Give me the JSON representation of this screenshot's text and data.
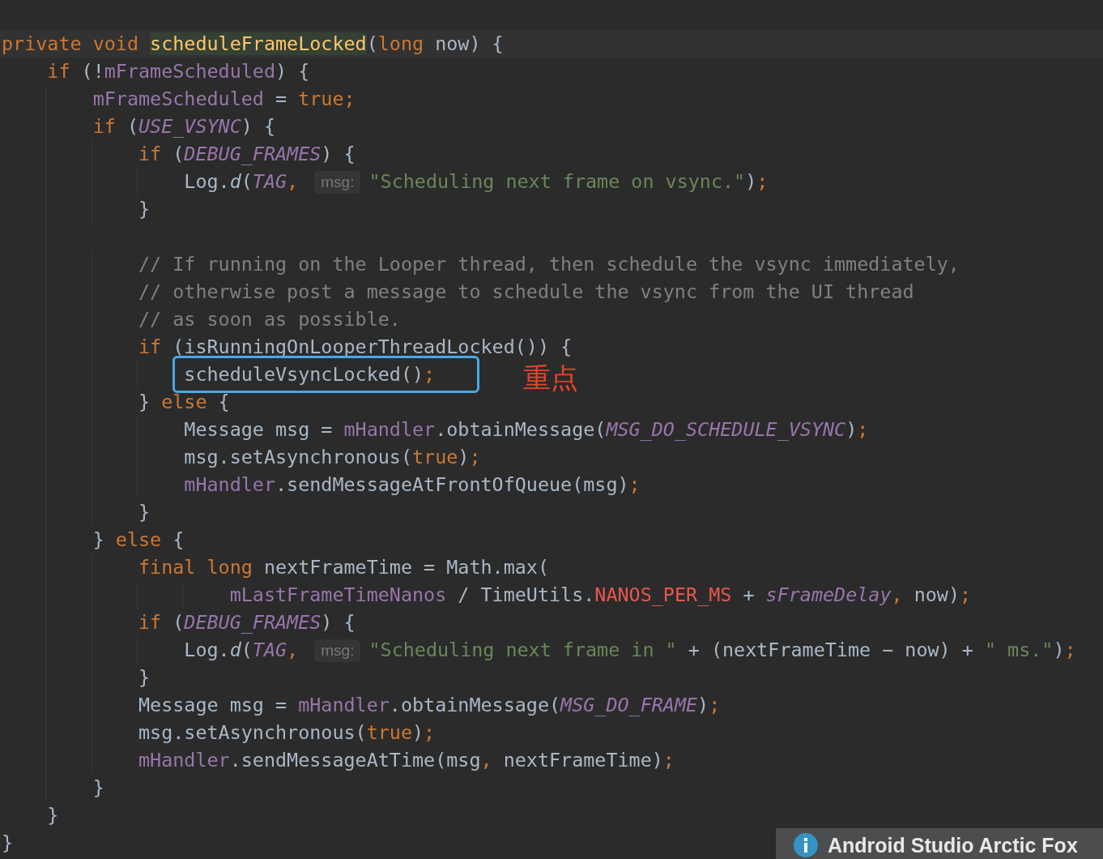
{
  "lines": [
    {
      "current": true,
      "tokens": [
        {
          "kind": "kw",
          "text": "private void "
        },
        {
          "kind": "decl",
          "text": "scheduleFrameLocked"
        },
        {
          "kind": "plain",
          "text": "("
        },
        {
          "kind": "kw",
          "text": "long "
        },
        {
          "kind": "plain",
          "text": "now) {"
        }
      ]
    },
    {
      "tokens": [
        {
          "kind": "kw",
          "text": "    if "
        },
        {
          "kind": "plain",
          "text": "(!"
        },
        {
          "kind": "field",
          "text": "mFrameScheduled"
        },
        {
          "kind": "plain",
          "text": ") {"
        }
      ]
    },
    {
      "tokens": [
        {
          "kind": "field",
          "text": "        mFrameScheduled"
        },
        {
          "kind": "plain",
          "text": " = "
        },
        {
          "kind": "kw",
          "text": "true;"
        }
      ]
    },
    {
      "tokens": [
        {
          "kind": "kw",
          "text": "        if "
        },
        {
          "kind": "plain",
          "text": "("
        },
        {
          "kind": "static",
          "text": "USE_VSYNC"
        },
        {
          "kind": "plain",
          "text": ") {"
        }
      ]
    },
    {
      "tokens": [
        {
          "kind": "kw",
          "text": "            if "
        },
        {
          "kind": "plain",
          "text": "("
        },
        {
          "kind": "static",
          "text": "DEBUG_FRAMES"
        },
        {
          "kind": "plain",
          "text": ") {"
        }
      ]
    },
    {
      "tokens": [
        {
          "kind": "plain",
          "text": "                Log."
        },
        {
          "kind": "italic",
          "text": "d"
        },
        {
          "kind": "plain",
          "text": "("
        },
        {
          "kind": "static",
          "text": "TAG"
        },
        {
          "kind": "kw",
          "text": ", "
        },
        {
          "kind": "hint",
          "text": "msg:"
        },
        {
          "kind": "string",
          "text": "\"Scheduling next frame on vsync.\""
        },
        {
          "kind": "plain",
          "text": ")"
        },
        {
          "kind": "kw",
          "text": ";"
        }
      ]
    },
    {
      "tokens": [
        {
          "kind": "plain",
          "text": "            }"
        }
      ]
    },
    {
      "blank": true
    },
    {
      "tokens": [
        {
          "kind": "comment",
          "text": "            // If running on the Looper thread, then schedule the vsync immediately,"
        }
      ]
    },
    {
      "tokens": [
        {
          "kind": "comment",
          "text": "            // otherwise post a message to schedule the vsync from the UI thread"
        }
      ]
    },
    {
      "tokens": [
        {
          "kind": "comment",
          "text": "            // as soon as possible."
        }
      ]
    },
    {
      "tokens": [
        {
          "kind": "kw",
          "text": "            if "
        },
        {
          "kind": "plain",
          "text": "(isRunningOnLooperThreadLocked()) {"
        }
      ]
    },
    {
      "boxed": true,
      "note": "重点",
      "tokens": [
        {
          "kind": "plain",
          "text": "                scheduleVsyncLocked()"
        },
        {
          "kind": "kw",
          "text": ";"
        }
      ]
    },
    {
      "tokens": [
        {
          "kind": "plain",
          "text": "            } "
        },
        {
          "kind": "kw",
          "text": "else "
        },
        {
          "kind": "plain",
          "text": "{"
        }
      ]
    },
    {
      "tokens": [
        {
          "kind": "plain",
          "text": "                Message msg = "
        },
        {
          "kind": "field",
          "text": "mHandler"
        },
        {
          "kind": "plain",
          "text": ".obtainMessage("
        },
        {
          "kind": "static",
          "text": "MSG_DO_SCHEDULE_VSYNC"
        },
        {
          "kind": "plain",
          "text": ")"
        },
        {
          "kind": "kw",
          "text": ";"
        }
      ]
    },
    {
      "tokens": [
        {
          "kind": "plain",
          "text": "                msg.setAsynchronous("
        },
        {
          "kind": "kw",
          "text": "true"
        },
        {
          "kind": "plain",
          "text": ")"
        },
        {
          "kind": "kw",
          "text": ";"
        }
      ]
    },
    {
      "tokens": [
        {
          "kind": "field",
          "text": "                mHandler"
        },
        {
          "kind": "plain",
          "text": ".sendMessageAtFrontOfQueue(msg)"
        },
        {
          "kind": "kw",
          "text": ";"
        }
      ]
    },
    {
      "tokens": [
        {
          "kind": "plain",
          "text": "            }"
        }
      ]
    },
    {
      "tokens": [
        {
          "kind": "plain",
          "text": "        } "
        },
        {
          "kind": "kw",
          "text": "else "
        },
        {
          "kind": "plain",
          "text": "{"
        }
      ]
    },
    {
      "tokens": [
        {
          "kind": "kw",
          "text": "            final long "
        },
        {
          "kind": "plain",
          "text": "nextFrameTime = Math.max("
        }
      ]
    },
    {
      "tokens": [
        {
          "kind": "field",
          "text": "                    mLastFrameTimeNanos"
        },
        {
          "kind": "plain",
          "text": " / TimeUtils."
        },
        {
          "kind": "constant",
          "text": "NANOS_PER_MS"
        },
        {
          "kind": "plain",
          "text": " + "
        },
        {
          "kind": "static",
          "text": "sFrameDelay"
        },
        {
          "kind": "kw",
          "text": ", "
        },
        {
          "kind": "plain",
          "text": "now)"
        },
        {
          "kind": "kw",
          "text": ";"
        }
      ]
    },
    {
      "tokens": [
        {
          "kind": "kw",
          "text": "            if "
        },
        {
          "kind": "plain",
          "text": "("
        },
        {
          "kind": "static",
          "text": "DEBUG_FRAMES"
        },
        {
          "kind": "plain",
          "text": ") {"
        }
      ]
    },
    {
      "tokens": [
        {
          "kind": "plain",
          "text": "                Log."
        },
        {
          "kind": "italic",
          "text": "d"
        },
        {
          "kind": "plain",
          "text": "("
        },
        {
          "kind": "static",
          "text": "TAG"
        },
        {
          "kind": "kw",
          "text": ", "
        },
        {
          "kind": "hint",
          "text": "msg:"
        },
        {
          "kind": "string",
          "text": "\"Scheduling next frame in \""
        },
        {
          "kind": "plain",
          "text": " + (nextFrameTime − now) + "
        },
        {
          "kind": "string",
          "text": "\" ms.\""
        },
        {
          "kind": "plain",
          "text": ")"
        },
        {
          "kind": "kw",
          "text": ";"
        }
      ]
    },
    {
      "tokens": [
        {
          "kind": "plain",
          "text": "            }"
        }
      ]
    },
    {
      "tokens": [
        {
          "kind": "plain",
          "text": "            Message msg = "
        },
        {
          "kind": "field",
          "text": "mHandler"
        },
        {
          "kind": "plain",
          "text": ".obtainMessage("
        },
        {
          "kind": "static",
          "text": "MSG_DO_FRAME"
        },
        {
          "kind": "plain",
          "text": ")"
        },
        {
          "kind": "kw",
          "text": ";"
        }
      ]
    },
    {
      "tokens": [
        {
          "kind": "plain",
          "text": "            msg.setAsynchronous("
        },
        {
          "kind": "kw",
          "text": "true"
        },
        {
          "kind": "plain",
          "text": ")"
        },
        {
          "kind": "kw",
          "text": ";"
        }
      ]
    },
    {
      "tokens": [
        {
          "kind": "field",
          "text": "            mHandler"
        },
        {
          "kind": "plain",
          "text": ".sendMessageAtTime(msg"
        },
        {
          "kind": "kw",
          "text": ", "
        },
        {
          "kind": "plain",
          "text": "nextFrameTime)"
        },
        {
          "kind": "kw",
          "text": ";"
        }
      ]
    },
    {
      "tokens": [
        {
          "kind": "plain",
          "text": "        }"
        }
      ]
    },
    {
      "tokens": [
        {
          "kind": "plain",
          "text": "    }"
        }
      ]
    },
    {
      "tokens": [
        {
          "kind": "plain",
          "text": "}"
        }
      ]
    }
  ],
  "notification": {
    "title": "Android Studio Arctic Fox"
  }
}
